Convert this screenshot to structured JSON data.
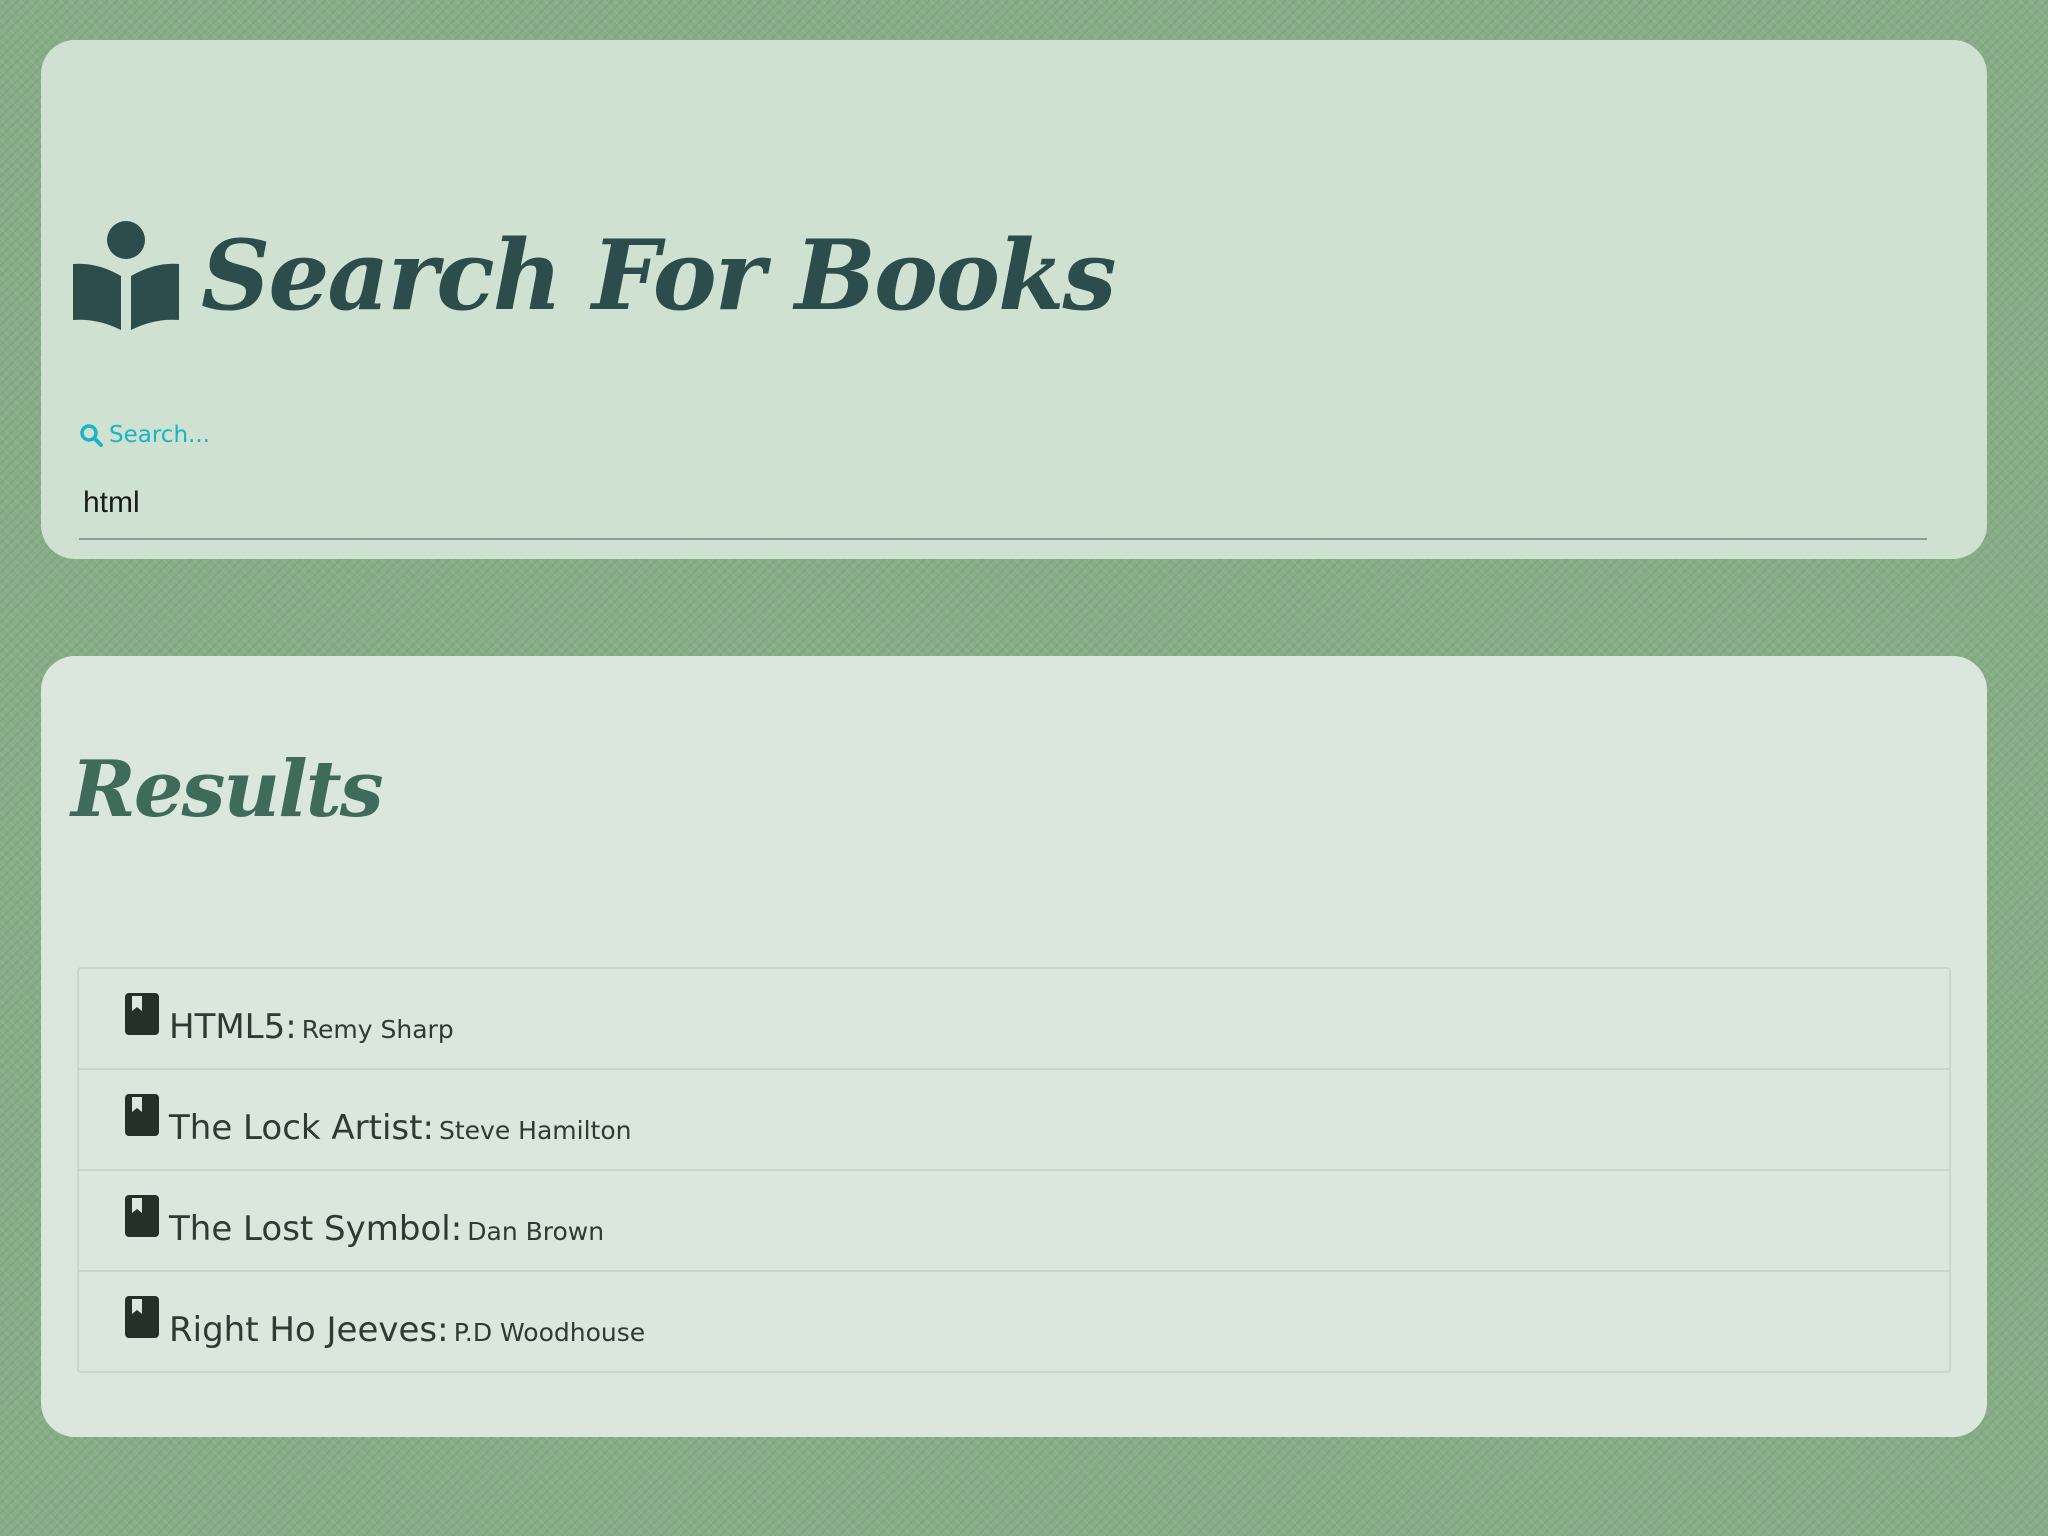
{
  "header": {
    "title": "Search For Books",
    "icon": "book-reader-icon"
  },
  "search": {
    "label": "Search...",
    "icon": "search-icon",
    "value": "html"
  },
  "results": {
    "title": "Results",
    "item_icon": "book-icon",
    "items": [
      {
        "title": "HTML5:",
        "author": "Remy Sharp"
      },
      {
        "title": "The Lock Artist:",
        "author": "Steve Hamilton"
      },
      {
        "title": "The Lost Symbol:",
        "author": "Dan Brown"
      },
      {
        "title": "Right Ho Jeeves:",
        "author": "P.D Woodhouse"
      }
    ]
  },
  "colors": {
    "background": "#86ad86",
    "title": "#2c4d4c",
    "accent": "#1ab3c8",
    "results_title": "#3f6b5d"
  }
}
